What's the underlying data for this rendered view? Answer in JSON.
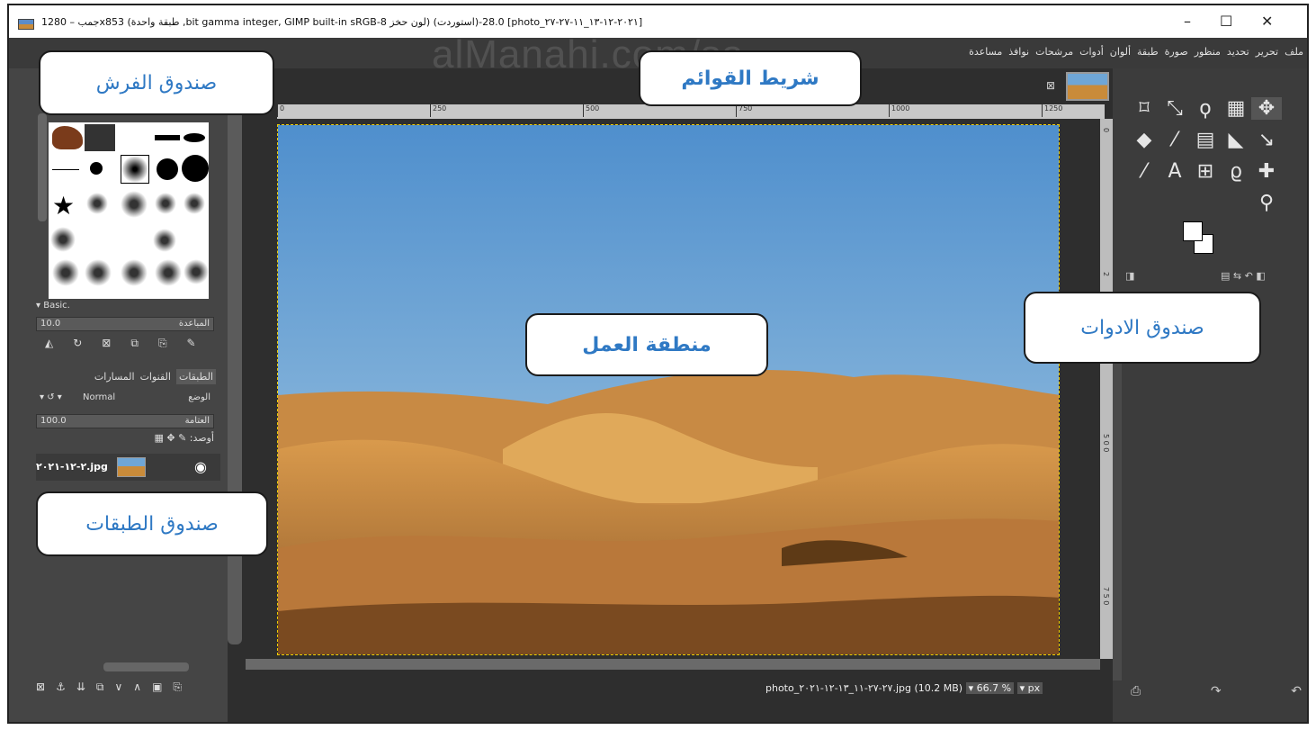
{
  "window": {
    "title": "جمب – 1280x853 (طبقة واحدة ,bit gamma integer, GIMP built-in sRGB-لون حخز 8) (استوردت)-28.0 [photo_٢٠٢١-١٢-١٣_١١-٢٧-٢٧]",
    "minimize": "–",
    "maximize": "☐",
    "close": "✕"
  },
  "menu": [
    "ملف",
    "تحرير",
    "تحديد",
    "منظور",
    "صورة",
    "طبقة",
    "ألوان",
    "أدوات",
    "مرشحات",
    "نوافذ",
    "مساعدة"
  ],
  "watermark": "alManahj.com/sa",
  "brushes": {
    "preset": "Basic.",
    "spacing_label": "المباعدة",
    "spacing_value": "10.0"
  },
  "layers": {
    "tabs": [
      "الطبقات",
      "القنوات",
      "المسارات"
    ],
    "mode_label": "الوضع",
    "mode_value": "Normal",
    "opacity_label": "العتامة",
    "opacity_value": "100.0",
    "lock_label": "أوصد:",
    "layer_name": "٢-١٢-٢٠٢١.jpg"
  },
  "ruler": {
    "top_ticks": [
      "0",
      "250",
      "500",
      "750",
      "1000",
      "1250"
    ],
    "right_ticks": [
      "0",
      "2",
      "5 0 0",
      "7 5 0"
    ]
  },
  "status": {
    "file": "photo_٢٧-٢٧-١١_١٣-١٢-٢٠٢١.jpg (10.2 MB)",
    "zoom": "66.7 %",
    "unit": "px"
  },
  "callouts": {
    "brush_box": "صندوق الفرش",
    "menu_bar": "شريط القوائم",
    "work_area": "منطقة العمل",
    "tools_box": "صندوق الادوات",
    "layers_box": "صندوق الطبقات"
  }
}
